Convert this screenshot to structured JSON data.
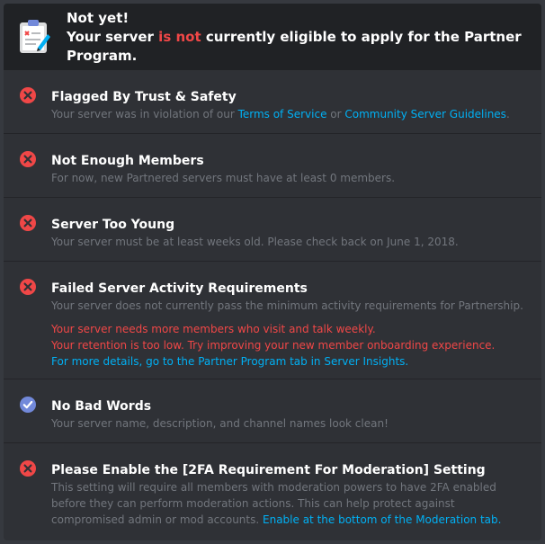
{
  "header": {
    "line1": "Not yet!",
    "line2_pre": "Your server ",
    "line2_emph": "is not",
    "line2_post": " currently eligible to apply for the Partner Program."
  },
  "requirements": [
    {
      "status": "fail",
      "title": "Flagged By Trust & Safety",
      "desc_pre": "Your server was in violation of our ",
      "link1": "Terms of Service",
      "desc_mid": " or ",
      "link2": "Community Server Guidelines",
      "desc_post": "."
    },
    {
      "status": "fail",
      "title": "Not Enough Members",
      "desc": "For now, new Partnered servers must have at least 0 members."
    },
    {
      "status": "fail",
      "title": "Server Too Young",
      "desc": "Your server must be at least weeks old. Please check back on June 1, 2018."
    },
    {
      "status": "fail",
      "title": "Failed Server Activity Requirements",
      "desc": "Your server does not currently pass the minimum activity requirements for Partnership.",
      "error1": "Your server needs more members who visit and talk weekly.",
      "error2": "Your retention is too low. Try improving your new member onboarding experience.",
      "details_link": "For more details, go to the Partner Program tab in Server Insights."
    },
    {
      "status": "pass",
      "title": "No Bad Words",
      "desc": "Your server name, description, and channel names look clean!"
    },
    {
      "status": "fail",
      "title": "Please Enable the [2FA Requirement For Moderation] Setting",
      "desc_pre": "This setting will require all members with moderation powers to have 2FA enabled before they can perform moderation actions. This can help protect against compromised admin or mod accounts. ",
      "link": "Enable at the bottom of the Moderation tab."
    }
  ],
  "icons": {
    "fail": "x-circle-icon",
    "pass": "checkmark-circle-icon",
    "header": "clipboard-icon"
  },
  "colors": {
    "fail": "#f04747",
    "pass": "#7289da",
    "link": "#00b0f4"
  }
}
